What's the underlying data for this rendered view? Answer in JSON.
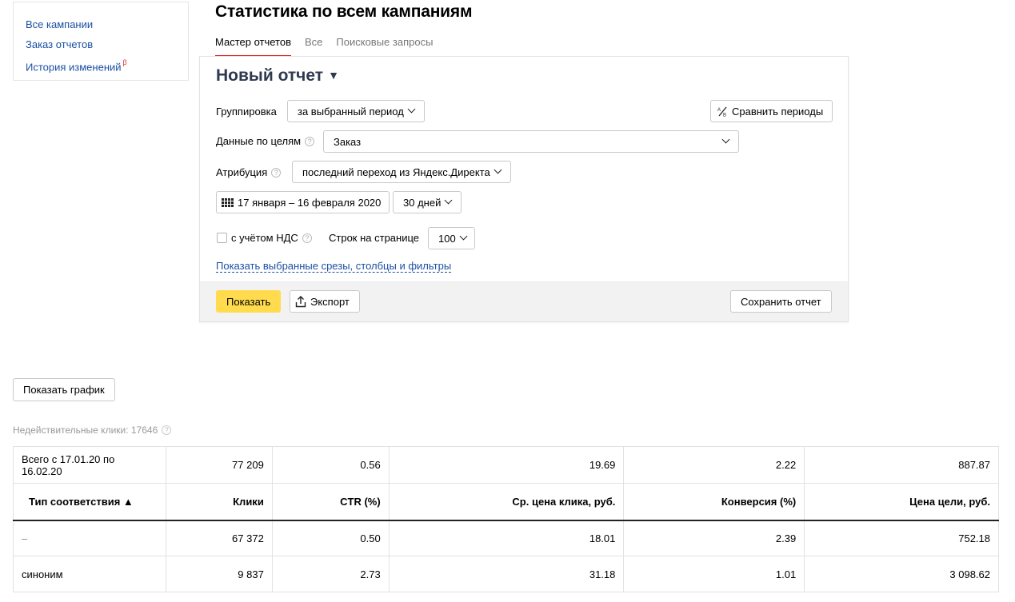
{
  "sidebar": {
    "items": [
      {
        "label": "Все кампании"
      },
      {
        "label": "Заказ отчетов"
      },
      {
        "label": "История изменений",
        "badge": "β"
      }
    ]
  },
  "header": {
    "title": "Статистика по всем кампаниям",
    "tabs": [
      {
        "label": "Мастер отчетов",
        "active": true
      },
      {
        "label": "Все",
        "active": false
      },
      {
        "label": "Поисковые запросы",
        "active": false
      }
    ]
  },
  "report": {
    "name": "Новый отчет",
    "name_arrow": "▼",
    "grouping_label": "Группировка",
    "grouping_value": "за выбранный период",
    "compare_button": "Сравнить периоды",
    "goals_label": "Данные по целям",
    "goals_value": "Заказ",
    "attribution_label": "Атрибуция",
    "attribution_value": "последний переход из Яндекс.Директа",
    "date_range": "17 января – 16 февраля 2020",
    "period_value": "30 дней",
    "vat_label": "с учётом НДС",
    "vat_checked": false,
    "rows_label": "Строк на странице",
    "rows_value": "100",
    "slices_link": "Показать выбранные срезы, столбцы и фильтры",
    "help_glyph": "?",
    "show_button": "Показать",
    "export_button": "Экспорт",
    "save_button": "Сохранить отчет"
  },
  "show_chart_button": "Показать график",
  "invalid_clicks": "Недействительные клики: 17646",
  "table": {
    "total": [
      "Всего с 17.01.20 по 16.02.20",
      "77 209",
      "0.56",
      "19.69",
      "2.22",
      "887.87"
    ],
    "columns": [
      "Тип соответствия ▲",
      "Клики",
      "CTR (%)",
      "Ср. цена клика, руб.",
      "Конверсия (%)",
      "Цена цели, руб."
    ],
    "rows": [
      [
        "–",
        "67 372",
        "0.50",
        "18.01",
        "2.39",
        "752.18"
      ],
      [
        "синоним",
        "9 837",
        "2.73",
        "31.18",
        "1.01",
        "3 098.62"
      ]
    ]
  },
  "colors": {
    "link": "#1a4fa3",
    "accent_tab": "#e02020",
    "primary_button": "#ffdb4d",
    "report_name": "#2f3a4f"
  }
}
